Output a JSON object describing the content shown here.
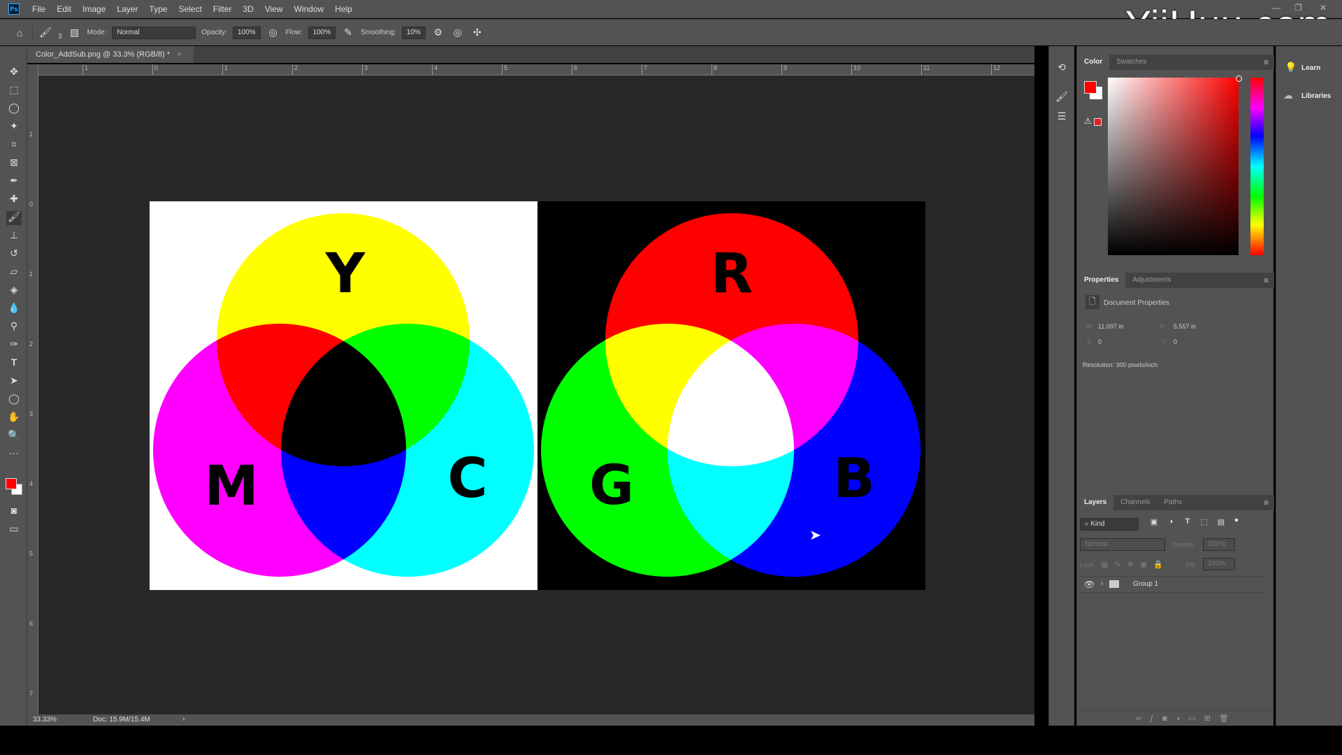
{
  "app": {
    "logo": "Ps",
    "watermark": "YiiHuu.com"
  },
  "menu": [
    "File",
    "Edit",
    "Image",
    "Layer",
    "Type",
    "Select",
    "Filter",
    "3D",
    "View",
    "Window",
    "Help"
  ],
  "window_controls": [
    "minimize",
    "restore",
    "close"
  ],
  "options": {
    "brush_size": "3",
    "mode_label": "Mode:",
    "mode_value": "Normal",
    "opacity_label": "Opacity:",
    "opacity_value": "100%",
    "flow_label": "Flow:",
    "flow_value": "100%",
    "smoothing_label": "Smoothing:",
    "smoothing_value": "10%"
  },
  "document": {
    "tab_title": "Color_AddSub.png @ 33.3% (RGB/8) *",
    "close": "×"
  },
  "rulers": {
    "top": [
      "1",
      "0",
      "1",
      "2",
      "3",
      "4",
      "5",
      "6",
      "7",
      "8",
      "9",
      "10",
      "11",
      "12"
    ],
    "left": [
      "1",
      "0",
      "1",
      "2",
      "3",
      "4",
      "5",
      "6",
      "7"
    ]
  },
  "artwork": {
    "subtractive": {
      "background": "#ffffff",
      "labels": {
        "yellow": "Y",
        "magenta": "M",
        "cyan": "C"
      },
      "colors": {
        "yellow": "#ffff00",
        "magenta": "#ff00ff",
        "cyan": "#00ffff"
      }
    },
    "additive": {
      "background": "#000000",
      "labels": {
        "red": "R",
        "green": "G",
        "blue": "B"
      },
      "colors": {
        "red": "#ff0000",
        "green": "#00ff00",
        "blue": "#0000ff"
      }
    }
  },
  "status": {
    "zoom": "33.33%",
    "doc": "Doc: 15.9M/15.4M",
    "arrow": "›"
  },
  "color_panel": {
    "tabs": [
      "Color",
      "Swatches"
    ],
    "foreground": "#ff0000",
    "background": "#ffffff"
  },
  "properties_panel": {
    "tabs": [
      "Properties",
      "Adjustments"
    ],
    "section": "Document Properties",
    "w_label": "W:",
    "w_value": "11.097 in",
    "h_label": "H:",
    "h_value": "5.557 in",
    "x_label": "X:",
    "x_value": "0",
    "y_label": "Y:",
    "y_value": "0",
    "resolution": "Resolution: 300 pixels/inch"
  },
  "layers_panel": {
    "tabs": [
      "Layers",
      "Channels",
      "Paths"
    ],
    "filter": "Kind",
    "blend": "Normal",
    "opacity_label": "Opacity:",
    "opacity_value": "100%",
    "lock_label": "Lock:",
    "fill_label": "Fill:",
    "fill_value": "100%",
    "layers": [
      {
        "name": "Group 1",
        "visible": true,
        "type": "group"
      }
    ]
  },
  "side_panels": {
    "learn": "Learn",
    "libraries": "Libraries"
  }
}
